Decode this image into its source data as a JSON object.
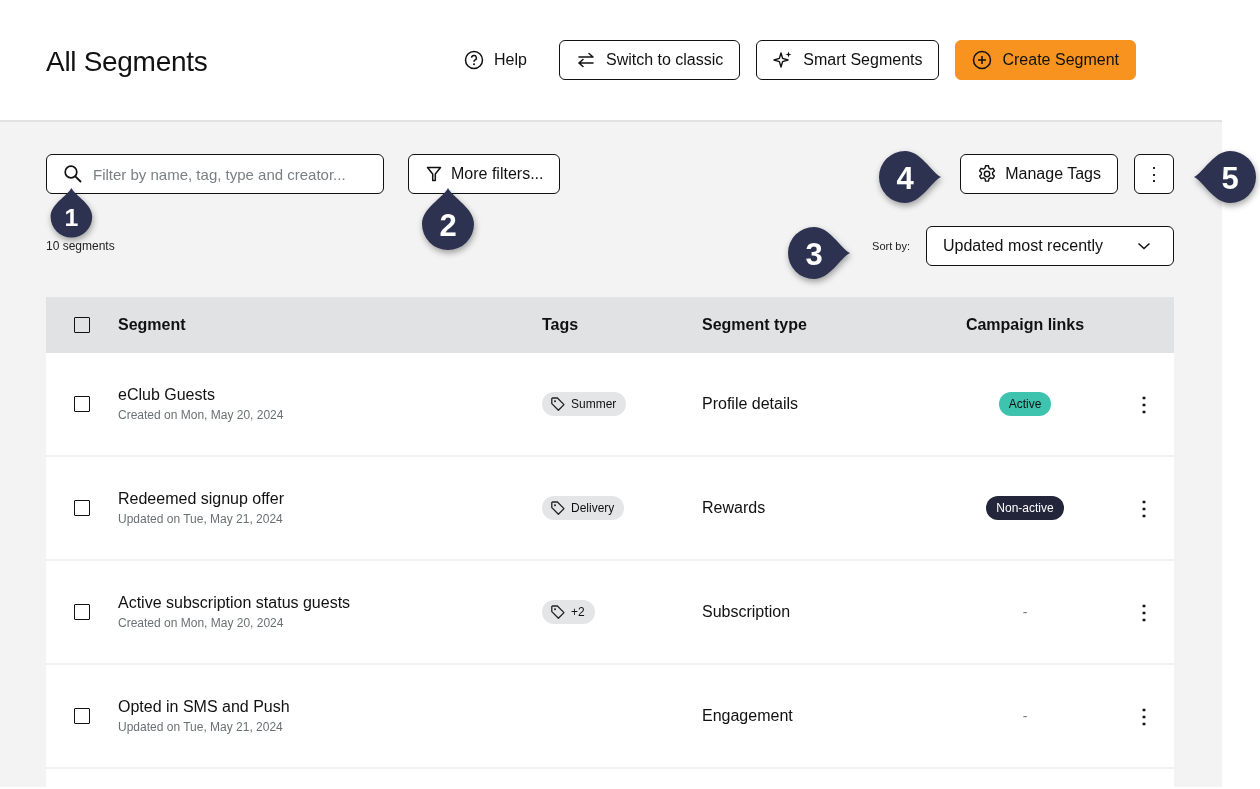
{
  "header": {
    "title": "All Segments",
    "actions": [
      {
        "kind": "help",
        "label": "Help"
      },
      {
        "kind": "switch",
        "label": "Switch to classic"
      },
      {
        "kind": "smart",
        "label": "Smart Segments"
      },
      {
        "kind": "create",
        "label": "Create Segment"
      }
    ]
  },
  "toolbar": {
    "search": {
      "placeholder": "Filter by name, tag, type and creator..."
    },
    "filters_button": "More filters...",
    "manage_tags_button": "Manage Tags",
    "more_button": "⋮"
  },
  "count": "10 segments",
  "sort": {
    "label": "Sort by:",
    "value": "Updated most recently"
  },
  "table": {
    "select_all": {
      "checked": false
    },
    "columns": [
      "Segment",
      "Tags",
      "Segment type",
      "Campaign links"
    ],
    "rows": [
      {
        "checked": false,
        "name": "eClub Guests",
        "date": "Created on Mon, May 20, 2024",
        "tags": [
          "Summer"
        ],
        "type": "Profile details",
        "campaign_link": {
          "kind": "active",
          "label": "Active"
        },
        "menu": "⋮"
      },
      {
        "checked": false,
        "name": "Redeemed signup offer",
        "date": "Updated on Tue, May 21, 2024",
        "tags": [
          "Delivery"
        ],
        "type": "Rewards",
        "campaign_link": {
          "kind": "dark",
          "label": "Non-active"
        },
        "menu": "⋮"
      },
      {
        "checked": false,
        "name": "Active subscription status guests",
        "date": "Created on Mon, May 20, 2024",
        "tags": [
          "+2"
        ],
        "type": "Subscription",
        "campaign_link": {
          "kind": "empty",
          "label": "-"
        },
        "menu": "⋮"
      },
      {
        "checked": false,
        "name": "Opted in SMS and Push",
        "date": "Updated on Tue, May 21, 2024",
        "tags": [],
        "type": "Engagement",
        "campaign_link": {
          "kind": "empty",
          "label": "-"
        },
        "menu": "⋮"
      }
    ]
  },
  "callouts": [
    {
      "number": "1",
      "kind": "up"
    },
    {
      "number": "2",
      "kind": "up"
    },
    {
      "number": "3",
      "kind": "right"
    },
    {
      "number": "4",
      "kind": "right"
    },
    {
      "number": "5",
      "kind": "left"
    }
  ]
}
